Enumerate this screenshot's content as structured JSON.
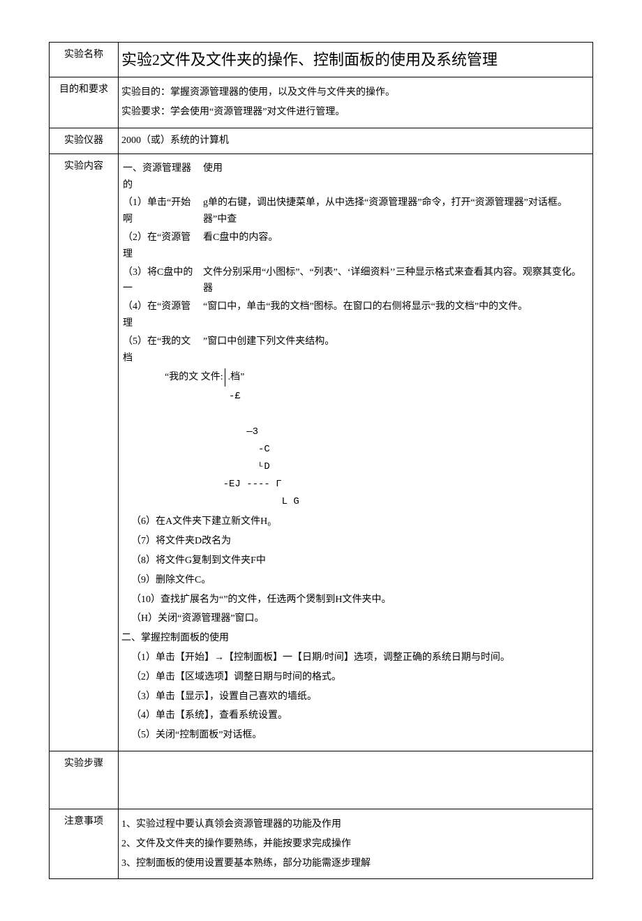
{
  "rows": {
    "name": {
      "label": "实验名称",
      "value": "实验2文件及文件夹的操作、控制面板的使用及系统管理"
    },
    "purpose": {
      "label": "目的和要求",
      "line1": "实验目的：掌握资源管理器的使用，以及文件与文件夹的操作。",
      "line2": "实验要求：学会使用“资源管理器”对文件进行管理。"
    },
    "instrument": {
      "label": "实验仪器",
      "value": "2000（或）系统的计算机"
    },
    "content": {
      "label": "实验内容",
      "sec1_left": [
        "一、资源管理器的",
        "（1）单击“开始啊",
        "（2）在“资源管理",
        "（3）将C盘中的一",
        "（4）在“资源管理",
        "（5）在“我的文档"
      ],
      "sec1_right": [
        "使用",
        "g单的右键，调出快捷菜单，从中选择“资源管理器”命令，打开“资源管理器”对话框。  器”中查",
        "看C盘中的内容。",
        "文件分别采用“小图标”、“列表”、‘详细资料’’三种显示格式来查看其内容。观察其变化。  器",
        "“窗口中，单击“我的文档”图标。在窗口的右侧将显示“我的文档”中的文件。",
        "”窗口中创建下列文件夹结构。"
      ],
      "tree_label_left": "“我的文 文件:",
      "tree_label_right": ".档”",
      "tree_lines": "          -£\n\n             —3\n               -C\n               ᴸD\n         -EJ ---- Γ\n                   L G",
      "items": [
        "（6）在A文件夹下建立新文件H₀",
        "（7）将文件夹D改名为",
        "（8）将文件G复制到文件夹F中",
        "（9）删除文件C。",
        "（10）查找扩展名为“”的文件，任选两个煲制到H文件夹中。",
        "（H）关闭“资源管理器”窗口。"
      ],
      "sec2_title": "二、掌握控制面板的使用",
      "sec2_items": [
        "（1）单击【开始】→【控制面板】一【日期/时间】选项，调整正确的系统日期与时间。",
        "（2）单击【区域选项】调整日期与时间的格式。",
        "（3）单击【显示】，设置自己喜欢的墙纸。",
        "（4）单击【系统】，查看系统设置。",
        "（5）关闭“控制面板”对话框。"
      ]
    },
    "steps": {
      "label": "实验步骤"
    },
    "notes": {
      "label": "注意事项",
      "items": [
        "1、实验过程中要认真领会资源管理器的功能及作用",
        "2、文件及文件夹的操作要熟练，并能按要求完成操作",
        "3、控制面板的使用设置要基本熟练，部分功能需逐步理解"
      ]
    }
  }
}
